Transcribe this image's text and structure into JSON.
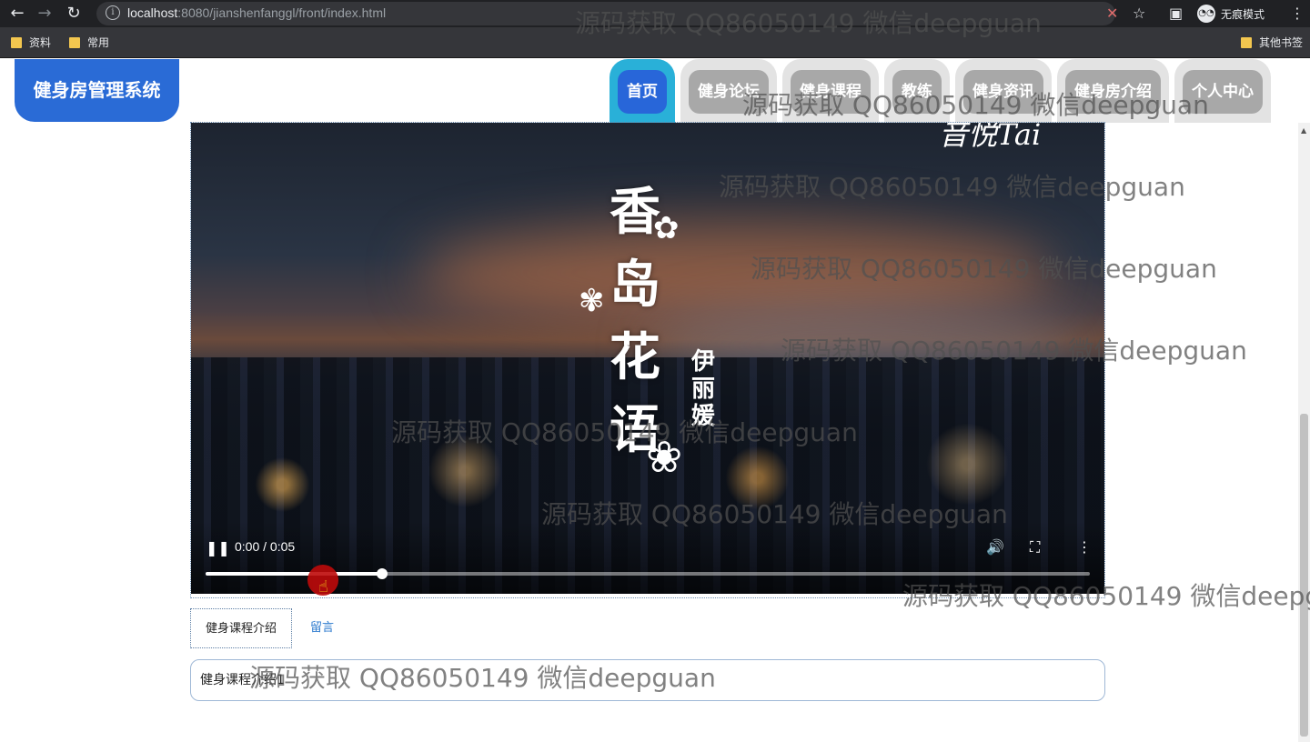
{
  "browser": {
    "url_host": "localhost",
    "url_rest": ":8080/jianshenfanggl/front/index.html",
    "incognito_label": "无痕模式",
    "bookmarks": [
      "资料",
      "常用"
    ],
    "other_bookmarks": "其他书签"
  },
  "header": {
    "logo": "健身房管理系统",
    "nav": [
      "首页",
      "健身论坛",
      "健身课程",
      "教练",
      "健身资讯",
      "健身房介绍",
      "个人中心"
    ],
    "active_index": 0
  },
  "video": {
    "title_chars": [
      "香",
      "岛",
      "花",
      "语"
    ],
    "singer_chars": [
      "伊",
      "丽",
      "媛"
    ],
    "top_text": "音悦Tai",
    "time": "0:00 / 0:05",
    "progress": 0.2,
    "state": "playing"
  },
  "subtabs": [
    "健身课程介绍",
    "留言"
  ],
  "active_subtab": 0,
  "content_text": "健身课程介绍1",
  "watermark": "源码获取 QQ86050149 微信deepguan"
}
